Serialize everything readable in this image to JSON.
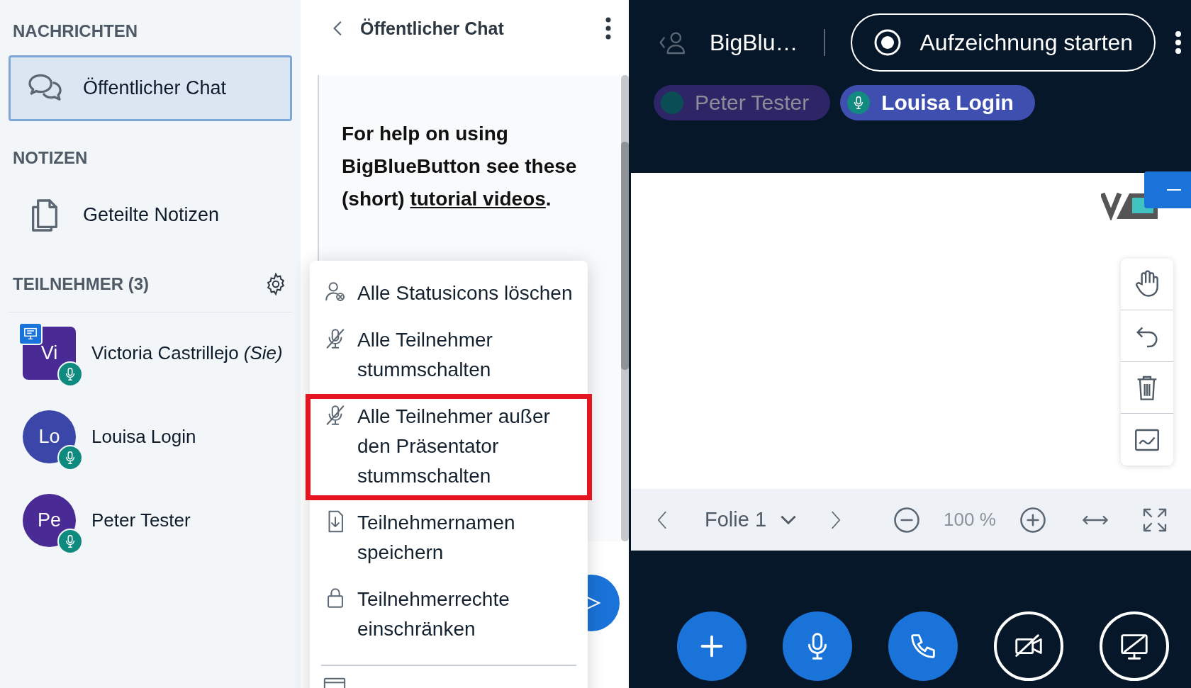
{
  "sidebar": {
    "messages_heading": "NACHRICHTEN",
    "chats": [
      {
        "label": "Öffentlicher Chat",
        "selected": true
      }
    ],
    "notes_heading": "NOTIZEN",
    "notes": [
      {
        "label": "Geteilte Notizen",
        "selected": false
      }
    ],
    "participants_heading": "TEILNEHMER (3)",
    "participants": [
      {
        "initials": "Vi",
        "name": "Victoria Castrillejo *(Sie)*",
        "color": "#4a2a94",
        "presenter": true,
        "rounded": false
      },
      {
        "initials": "Lo",
        "name": "Louisa Login",
        "color": "#3a46a8",
        "presenter": false,
        "rounded": true
      },
      {
        "initials": "Pe",
        "name": "Peter Tester",
        "color": "#4a2a94",
        "presenter": false,
        "rounded": true
      }
    ]
  },
  "chat": {
    "title": "Öffentlicher Chat",
    "message": "For help on using BigBlueButton see these (short) ",
    "link": "tutorial videos",
    "message_end": "."
  },
  "menu": {
    "items": [
      {
        "kind": "user",
        "label": "Alle Statusicons löschen",
        "highlighted": false
      },
      {
        "kind": "mic",
        "label": "Alle Teilnehmer stummschalten",
        "highlighted": false
      },
      {
        "kind": "mic",
        "label": "Alle Teilnehmer außer den Präsentator stummschalten",
        "highlighted": true
      },
      {
        "kind": "download",
        "label": "Teilnehmernamen speichern",
        "highlighted": false
      },
      {
        "kind": "lock",
        "label": "Teilnehmerrechte einschränken",
        "highlighted": false
      }
    ]
  },
  "topbar": {
    "meeting": "BigBlu…",
    "record_label": "Aufzeichnung starten"
  },
  "talkers": [
    {
      "name": "Peter Tester",
      "active": false
    },
    {
      "name": "Louisa Login",
      "active": true
    }
  ],
  "presentation": {
    "slide": "Folie 1",
    "zoom": "100 %"
  },
  "actions": [
    {
      "on": true
    },
    {
      "on": true
    },
    {
      "on": true
    },
    {
      "on": false
    },
    {
      "on": false
    }
  ]
}
